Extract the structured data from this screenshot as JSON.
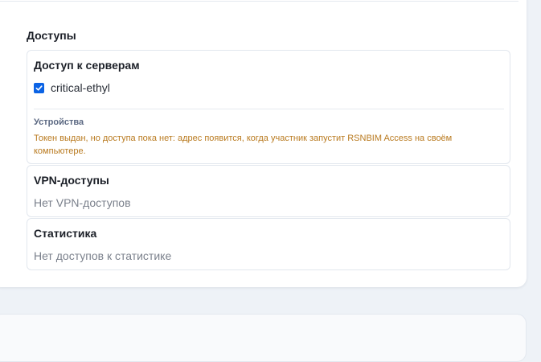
{
  "access": {
    "section_title": "Доступы",
    "servers": {
      "title": "Доступ к серверам",
      "items": [
        {
          "name": "critical-ethyl",
          "checked": true
        }
      ],
      "devices_title": "Устройства",
      "devices_note": "Токен выдан, но доступа пока нет: адрес появится, когда участник запустит RSNBIM Access на своём компьютере."
    },
    "vpn": {
      "title": "VPN-доступы",
      "empty": "Нет VPN-доступов"
    },
    "stats": {
      "title": "Статистика",
      "empty": "Нет доступов к статистике"
    }
  },
  "colors": {
    "accent": "#0b63e5",
    "warning_text": "#b97a1f",
    "muted_text": "#7b818c",
    "subheading": "#5b6882"
  },
  "icons": {
    "checkbox": "check-icon"
  }
}
